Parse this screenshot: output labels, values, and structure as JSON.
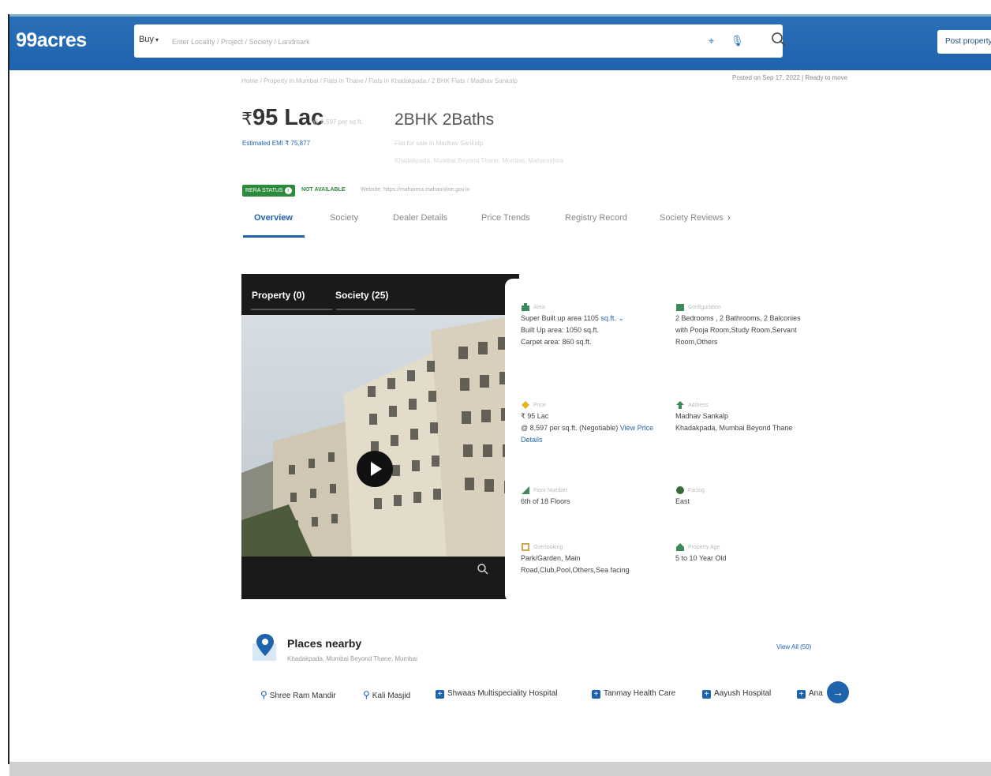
{
  "header": {
    "logo": "99acres",
    "buy_label": "Buy",
    "search_placeholder": "Enter Locality / Project / Society / Landmark",
    "post_property_label": "Post property"
  },
  "breadcrumb": "Home / Property in Mumbai / Flats in Thane / Flats in Khadakpada / 2 BHK Flats / Madhav Sankalp",
  "posted": "Posted on Sep 17, 2022 | Ready to move",
  "listing": {
    "price": "95 Lac",
    "price_symbol": "₹",
    "price_per_sqft": "@ 8,597 per sq.ft.",
    "emi": "Estimated EMI ₹ 75,877",
    "title": "2BHK 2Baths",
    "sub1": "Flat for sale in Madhav Sankalp",
    "sub2": "Khadakpada, Mumbai Beyond Thane, Mumbai, Maharashtra"
  },
  "rera": {
    "status_label": "RERA STATUS",
    "status_value": "NOT AVAILABLE",
    "website": "Website: https://maharera.mahaonline.gov.in"
  },
  "tabs": [
    "Overview",
    "Society",
    "Dealer Details",
    "Price Trends",
    "Registry Record",
    "Society Reviews"
  ],
  "tabs_more": "›",
  "gallery": {
    "tab_property": "Property (0)",
    "tab_society": "Society (25)"
  },
  "details": {
    "area": {
      "label": "Area",
      "super_builtup": "Super Built up area 1105",
      "unit": "sq.ft.",
      "builtup": "Built Up area: 1050 sq.ft.",
      "carpet": "Carpet area: 860 sq.ft."
    },
    "configuration": {
      "label": "Configuration",
      "value": "2 Bedrooms , 2 Bathrooms, 2 Balconies with Pooja Room,Study Room,Servant Room,Others"
    },
    "price": {
      "label": "Price",
      "value": "₹ 95 Lac",
      "per_sqft": "@ 8,597 per sq.ft. (Negotiable)",
      "link": "View Price Details"
    },
    "address": {
      "label": "Address",
      "line1": "Madhav Sankalp",
      "line2": "Khadakpada, Mumbai Beyond Thane"
    },
    "floor": {
      "label": "Floor Number",
      "value": "6th of 18 Floors"
    },
    "facing": {
      "label": "Facing",
      "value": "East"
    },
    "overlooking": {
      "label": "Overlooking",
      "value": "Park/Garden, Main Road,Club,Pool,Others,Sea facing"
    },
    "age": {
      "label": "Property Age",
      "value": "5 to 10 Year Old"
    }
  },
  "places": {
    "title": "Places nearby",
    "subtitle": "Khadakpada, Mumbai Beyond Thane, Mumbai",
    "view_all": "View All (50)",
    "items": [
      {
        "name": "Shree Ram Mandir",
        "type": "pin"
      },
      {
        "name": "Kali Masjid",
        "type": "pin"
      },
      {
        "name": "Shwaas Multispeciality Hospital",
        "type": "hospital"
      },
      {
        "name": "Tanmay Health Care",
        "type": "hospital"
      },
      {
        "name": "Aayush Hospital",
        "type": "hospital"
      },
      {
        "name": "Ana",
        "type": "hospital"
      }
    ]
  },
  "colors": {
    "brand_blue": "#1f63ad",
    "rera_green": "#2e8b3e"
  }
}
